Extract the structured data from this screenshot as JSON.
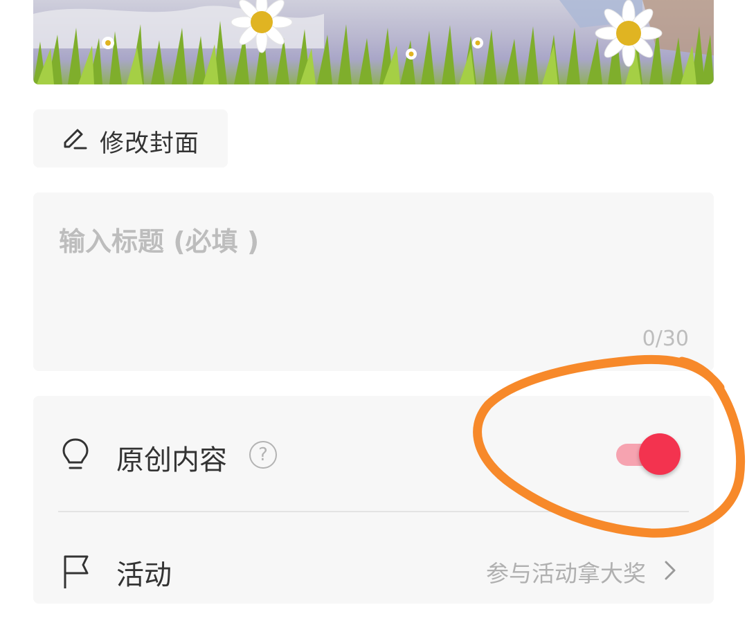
{
  "cover": {
    "edit_label": "修改封面",
    "edit_icon": "pencil-icon"
  },
  "title_field": {
    "placeholder": "输入标题 (必填 )",
    "counter": "0/30"
  },
  "options": {
    "original": {
      "label": "原创内容",
      "icon": "lightbulb-icon",
      "help_glyph": "?",
      "enabled": true
    },
    "activity": {
      "label": "活动",
      "icon": "flag-icon",
      "hint": "参与活动拿大奖",
      "chevron_icon": "chevron-right-icon"
    }
  },
  "colors": {
    "accent": "#f3334f",
    "accent_track": "#f6a3b0",
    "annotation": "#f7892a"
  }
}
